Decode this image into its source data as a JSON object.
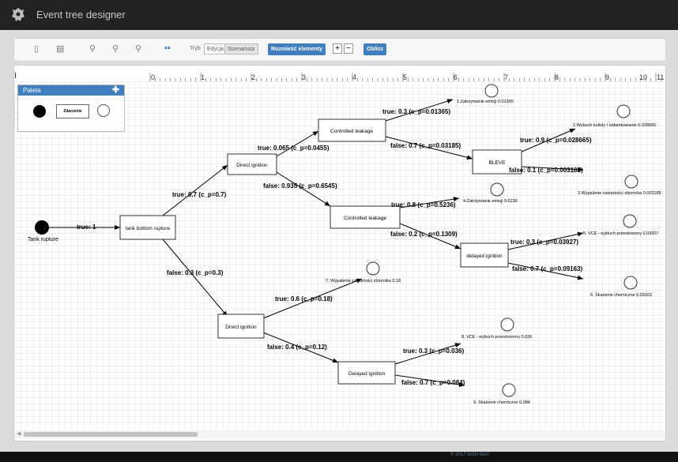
{
  "app": {
    "title": "Event tree designer",
    "footer": "© 2017 WSH WAT"
  },
  "toolbar": {
    "icons": [
      "new-file-icon",
      "open-file-icon",
      "zoom-in-icon",
      "zoom-reset-icon",
      "zoom-out-icon",
      "grid-icon"
    ],
    "mode_label": "Tryb",
    "mode_options": [
      "Edycja",
      "Scenariusz"
    ],
    "mode_selected": "Scenariusz",
    "arrange_label": "Rozmieść elementy",
    "plus_label": "+",
    "minus_label": "−",
    "compute_label": "Oblicz"
  },
  "ruler": {
    "cursor": "I",
    "ticks": [
      "0",
      "1",
      "2",
      "3",
      "4",
      "5",
      "6",
      "7",
      "8",
      "9",
      "10",
      "11"
    ]
  },
  "palette": {
    "title": "Paleta",
    "plus": "✚",
    "event_label": "Zdarzenie"
  },
  "tree": {
    "initiator": "Tank rupture",
    "nodes": {
      "n1": "tank bottom rupture",
      "n2": "Direct ignition",
      "n3": "Direct ignition",
      "n4": "Controlled leakage",
      "n5": "Controlled leakage",
      "n6": "Delayed ignition",
      "n7": "BLEVE",
      "n8": "delayed ignition"
    },
    "edges": {
      "e0": "true: 1",
      "e1": "true: 0.7 (c_p=0.7)",
      "e2": "false: 0.3 (c_p=0.3)",
      "e3": "true: 0.065 (c_p=0.0455)",
      "e4": "false: 0.935 (c_p=0.6545)",
      "e5": "true: 0.6 (c_p=0.18)",
      "e6": "false: 0.4 (c_p=0.12)",
      "e7": "true: 0.3 (c_p=0.01365)",
      "e8": "false: 0.7 (c_p=0.03185)",
      "e9": "true: 0.8 (c_p=0.5236)",
      "e10": "false: 0.2 (c_p=0.1309)",
      "e11": "true: 0.3 (c_p=0.036)",
      "e12": "false: 0.7 (c_p=0.084)",
      "e13": "true: 0.9 (c_p=0.028665)",
      "e14": "false: 0.1 (c_p=0.003185)",
      "e15": "true: 0.3 (c_p=0.03927)",
      "e16": "false: 0.7 (c_p=0.09163)"
    },
    "outcomes": {
      "o1": "1.Zatrzymanie emisji 0.01365",
      "o2": "2.Wybuch kulisty i odłamkowanie 0.028665",
      "o3": "3.Wypalenie zawartości zbiornika 0.003185",
      "o4": "4.Zatrzymanie emisji 0.5236",
      "o5": "5. VCE - wybuch przestrzenny 0.03927",
      "o6": "6. Skażenie chemiczne 0.09163",
      "o7": "7. Wypalenie zawartości zbiornika 0.18",
      "o8": "8. VCE - wybuch przestrzenny 0.036",
      "o9": "9. Skażenie chemiczne 0.084"
    }
  }
}
